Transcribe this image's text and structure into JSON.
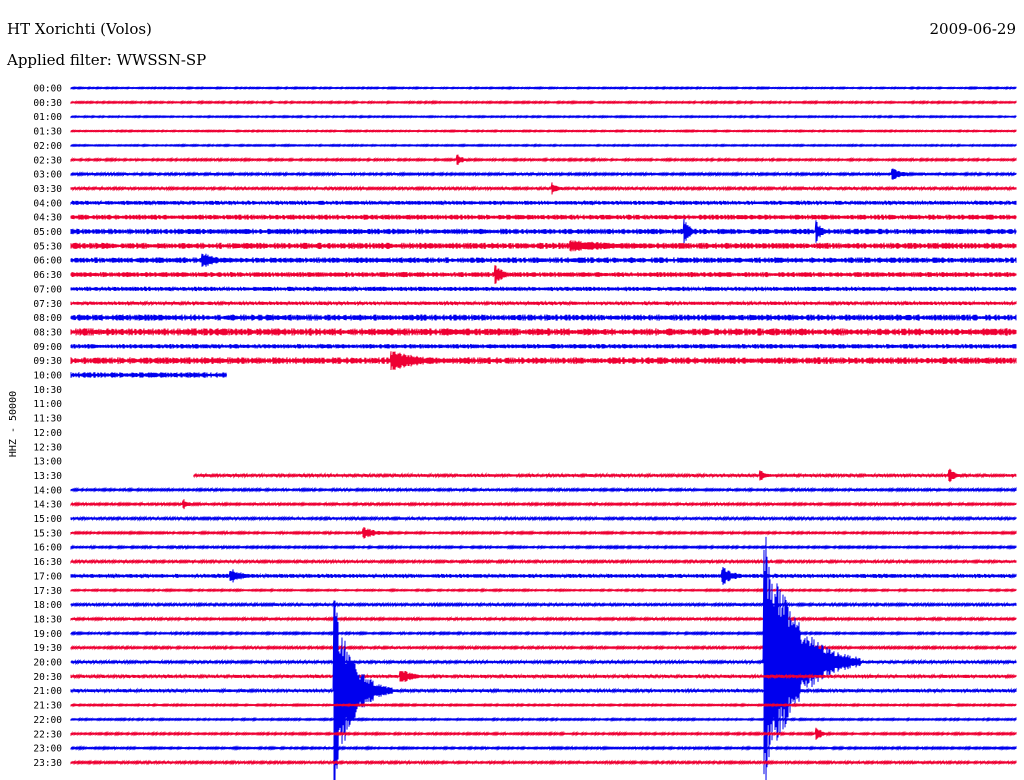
{
  "header": {
    "station": "HT Xorichti (Volos)",
    "date": "2009-06-29",
    "filter": "Applied filter: WWSSN-SP"
  },
  "chart_data": {
    "type": "line",
    "ylabel": "HHZ - 50000",
    "colors": [
      "#0000ee",
      "#ee0033"
    ],
    "rows": [
      {
        "label": "00:00",
        "start": 0,
        "end": 1,
        "noise": 0.5
      },
      {
        "label": "00:30",
        "start": 0,
        "end": 1,
        "noise": 0.6
      },
      {
        "label": "01:00",
        "start": 0,
        "end": 1,
        "noise": 0.5
      },
      {
        "label": "01:30",
        "start": 0,
        "end": 1,
        "noise": 0.5
      },
      {
        "label": "02:00",
        "start": 0,
        "end": 1,
        "noise": 0.5
      },
      {
        "label": "02:30",
        "start": 0,
        "end": 1,
        "noise": 0.7
      },
      {
        "label": "03:00",
        "start": 0,
        "end": 1,
        "noise": 0.8
      },
      {
        "label": "03:30",
        "start": 0,
        "end": 1,
        "noise": 0.9
      },
      {
        "label": "04:00",
        "start": 0,
        "end": 1,
        "noise": 1.4
      },
      {
        "label": "04:30",
        "start": 0,
        "end": 1,
        "noise": 1.8
      },
      {
        "label": "05:00",
        "start": 0,
        "end": 1,
        "noise": 2.0
      },
      {
        "label": "05:30",
        "start": 0,
        "end": 1,
        "noise": 2.2
      },
      {
        "label": "06:00",
        "start": 0,
        "end": 1,
        "noise": 2.0
      },
      {
        "label": "06:30",
        "start": 0,
        "end": 1,
        "noise": 1.8
      },
      {
        "label": "07:00",
        "start": 0,
        "end": 1,
        "noise": 1.5
      },
      {
        "label": "07:30",
        "start": 0,
        "end": 1,
        "noise": 1.2
      },
      {
        "label": "08:00",
        "start": 0,
        "end": 1,
        "noise": 2.2
      },
      {
        "label": "08:30",
        "start": 0,
        "end": 1,
        "noise": 2.6
      },
      {
        "label": "09:00",
        "start": 0,
        "end": 1,
        "noise": 1.6
      },
      {
        "label": "09:30",
        "start": 0,
        "end": 1,
        "noise": 2.4
      },
      {
        "label": "10:00",
        "start": 0,
        "end": 0.165,
        "noise": 2.0
      },
      {
        "label": "10:30",
        "start": 0,
        "end": 0,
        "noise": 0
      },
      {
        "label": "11:00",
        "start": 0,
        "end": 0,
        "noise": 0
      },
      {
        "label": "11:30",
        "start": 0,
        "end": 0,
        "noise": 0
      },
      {
        "label": "12:00",
        "start": 0,
        "end": 0,
        "noise": 0
      },
      {
        "label": "12:30",
        "start": 0,
        "end": 0,
        "noise": 0
      },
      {
        "label": "13:00",
        "start": 0,
        "end": 0,
        "noise": 0
      },
      {
        "label": "13:30",
        "start": 0.13,
        "end": 1,
        "noise": 1.0
      },
      {
        "label": "14:00",
        "start": 0,
        "end": 1,
        "noise": 0.8
      },
      {
        "label": "14:30",
        "start": 0,
        "end": 1,
        "noise": 0.8
      },
      {
        "label": "15:00",
        "start": 0,
        "end": 1,
        "noise": 0.9
      },
      {
        "label": "15:30",
        "start": 0,
        "end": 1,
        "noise": 0.7
      },
      {
        "label": "16:00",
        "start": 0,
        "end": 1,
        "noise": 0.7
      },
      {
        "label": "16:30",
        "start": 0,
        "end": 1,
        "noise": 0.9
      },
      {
        "label": "17:00",
        "start": 0,
        "end": 1,
        "noise": 1.4
      },
      {
        "label": "17:30",
        "start": 0,
        "end": 1,
        "noise": 0.6
      },
      {
        "label": "18:00",
        "start": 0,
        "end": 1,
        "noise": 0.9
      },
      {
        "label": "18:30",
        "start": 0,
        "end": 1,
        "noise": 0.8
      },
      {
        "label": "19:00",
        "start": 0,
        "end": 1,
        "noise": 0.7
      },
      {
        "label": "19:30",
        "start": 0,
        "end": 1,
        "noise": 0.8
      },
      {
        "label": "20:00",
        "start": 0,
        "end": 1,
        "noise": 1.0
      },
      {
        "label": "20:30",
        "start": 0,
        "end": 1,
        "noise": 1.1
      },
      {
        "label": "21:00",
        "start": 0,
        "end": 1,
        "noise": 1.1
      },
      {
        "label": "21:30",
        "start": 0,
        "end": 1,
        "noise": 0.6
      },
      {
        "label": "22:00",
        "start": 0,
        "end": 1,
        "noise": 0.6
      },
      {
        "label": "22:30",
        "start": 0,
        "end": 1,
        "noise": 0.7
      },
      {
        "label": "23:00",
        "start": 0,
        "end": 1,
        "noise": 0.7
      },
      {
        "label": "23:30",
        "start": 0,
        "end": 1,
        "noise": 0.8
      }
    ],
    "events": [
      {
        "row": 5,
        "pos": 0.41,
        "amp": 5,
        "dur": 0.02
      },
      {
        "row": 6,
        "pos": 0.87,
        "amp": 6,
        "dur": 0.04
      },
      {
        "row": 7,
        "pos": 0.51,
        "amp": 6,
        "dur": 0.02
      },
      {
        "row": 10,
        "pos": 0.65,
        "amp": 12,
        "dur": 0.02
      },
      {
        "row": 10,
        "pos": 0.79,
        "amp": 9,
        "dur": 0.02
      },
      {
        "row": 11,
        "pos": 0.53,
        "amp": 6,
        "dur": 0.2
      },
      {
        "row": 12,
        "pos": 0.14,
        "amp": 8,
        "dur": 0.05
      },
      {
        "row": 13,
        "pos": 0.45,
        "amp": 9,
        "dur": 0.03
      },
      {
        "row": 19,
        "pos": 0.34,
        "amp": 10,
        "dur": 0.12
      },
      {
        "row": 27,
        "pos": 0.73,
        "amp": 7,
        "dur": 0.02
      },
      {
        "row": 27,
        "pos": 0.93,
        "amp": 8,
        "dur": 0.02
      },
      {
        "row": 29,
        "pos": 0.12,
        "amp": 5,
        "dur": 0.02
      },
      {
        "row": 31,
        "pos": 0.31,
        "amp": 6,
        "dur": 0.05
      },
      {
        "row": 34,
        "pos": 0.17,
        "amp": 8,
        "dur": 0.04
      },
      {
        "row": 34,
        "pos": 0.69,
        "amp": 10,
        "dur": 0.04
      },
      {
        "row": 40,
        "pos": 0.735,
        "amp": 130,
        "dur": 0.1
      },
      {
        "row": 42,
        "pos": 0.28,
        "amp": 90,
        "dur": 0.06
      },
      {
        "row": 41,
        "pos": 0.35,
        "amp": 8,
        "dur": 0.04
      },
      {
        "row": 45,
        "pos": 0.79,
        "amp": 6,
        "dur": 0.02
      }
    ]
  }
}
